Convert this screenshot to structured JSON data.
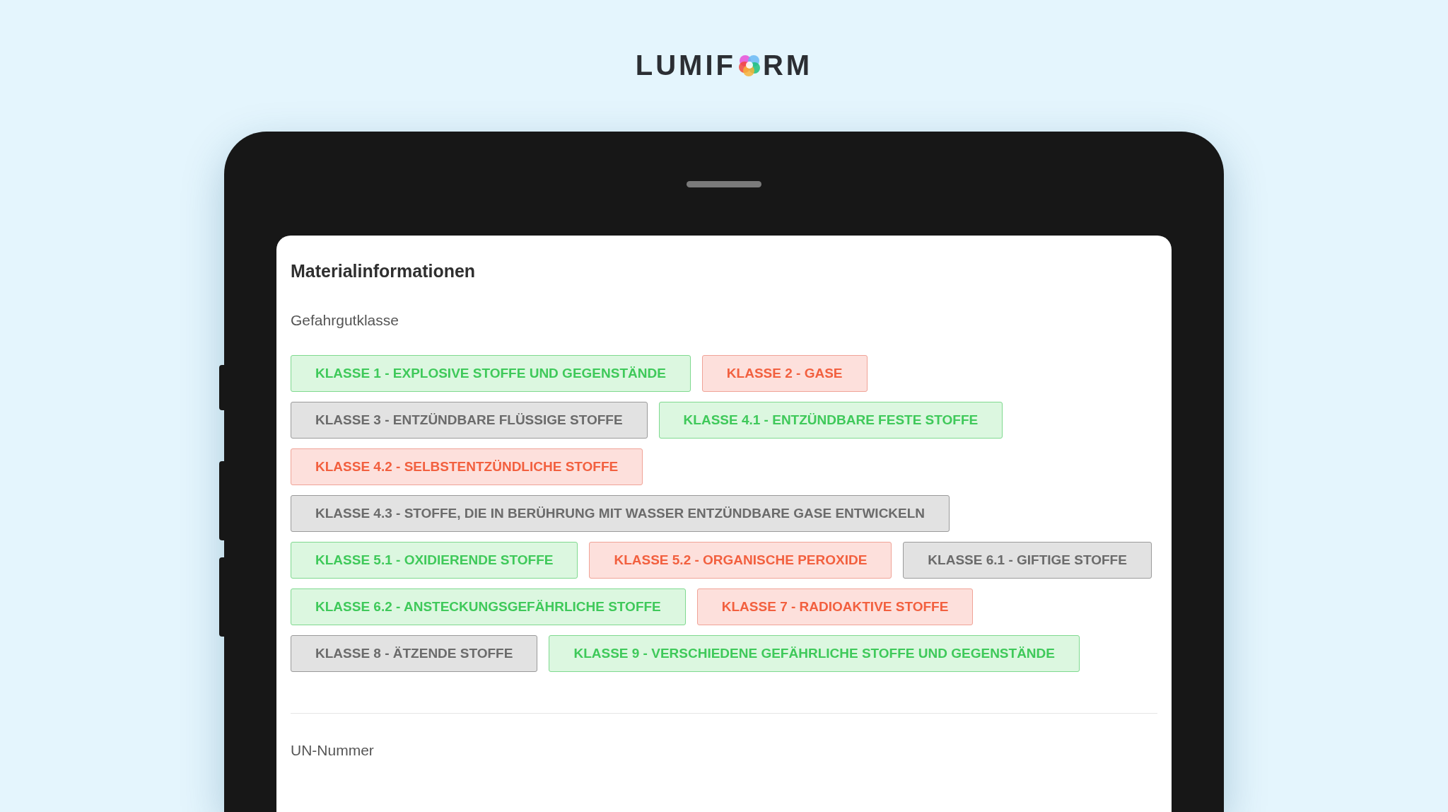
{
  "logo": {
    "before": "LUMIF",
    "after": "RM"
  },
  "form": {
    "title": "Materialinformationen",
    "field_label": "Gefahrgutklasse",
    "options": [
      {
        "label": "KLASSE 1 - EXPLOSIVE STOFFE UND GEGENSTÄNDE",
        "kind": "green"
      },
      {
        "label": "KLASSE 2 - GASE",
        "kind": "red"
      },
      {
        "label": "KLASSE 3 - ENTZÜNDBARE FLÜSSIGE STOFFE",
        "kind": "gray"
      },
      {
        "label": "KLASSE 4.1 - ENTZÜNDBARE FESTE STOFFE",
        "kind": "green"
      },
      {
        "label": "KLASSE 4.2 - SELBSTENTZÜNDLICHE STOFFE",
        "kind": "red"
      },
      {
        "label": "KLASSE 4.3 - STOFFE, DIE IN BERÜHRUNG MIT WASSER ENTZÜNDBARE GASE ENTWICKELN",
        "kind": "gray"
      },
      {
        "label": "KLASSE 5.1 - OXIDIERENDE STOFFE",
        "kind": "green"
      },
      {
        "label": "KLASSE 5.2 - ORGANISCHE PEROXIDE",
        "kind": "red"
      },
      {
        "label": "KLASSE 6.1 - GIFTIGE STOFFE",
        "kind": "gray"
      },
      {
        "label": "KLASSE 6.2 - ANSTECKUNGSGEFÄHRLICHE STOFFE",
        "kind": "green"
      },
      {
        "label": "KLASSE 7 - RADIOAKTIVE STOFFE",
        "kind": "red"
      },
      {
        "label": "KLASSE 8 - ÄTZENDE STOFFE",
        "kind": "gray"
      },
      {
        "label": "KLASSE 9 - VERSCHIEDENE GEFÄHRLICHE STOFFE UND GEGENSTÄNDE",
        "kind": "green"
      }
    ],
    "next_field_label": "UN-Nummer"
  }
}
